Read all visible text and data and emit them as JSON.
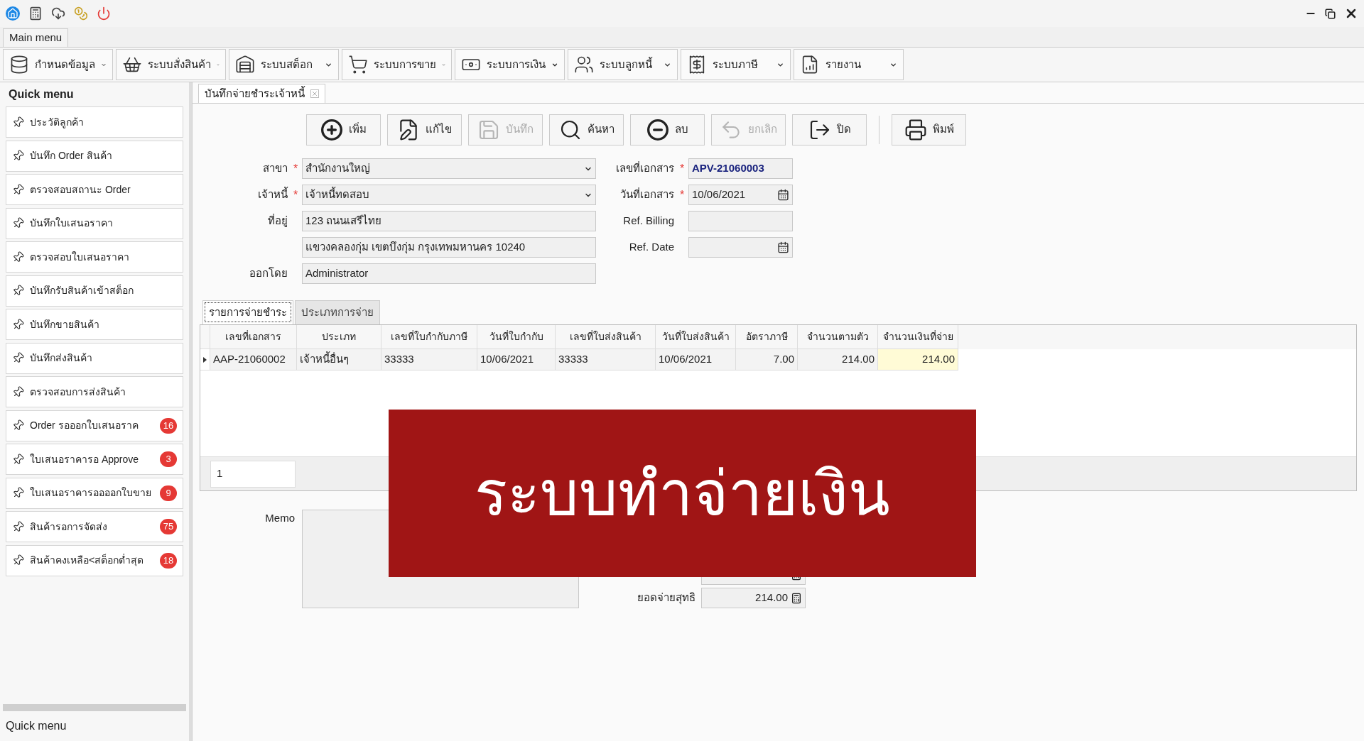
{
  "main_menu_tab": "Main menu",
  "menu_buttons": [
    {
      "label": "กำหนดข้อมูล"
    },
    {
      "label": "ระบบสั่งสินค้า"
    },
    {
      "label": "ระบบสต็อก"
    },
    {
      "label": "ระบบการขาย"
    },
    {
      "label": "ระบบการเงิน"
    },
    {
      "label": "ระบบลูกหนี้"
    },
    {
      "label": "ระบบภาษี"
    },
    {
      "label": "รายงาน"
    }
  ],
  "sidebar": {
    "title": "Quick menu",
    "items": [
      {
        "label": "ประวัติลูกค้า"
      },
      {
        "label": "บันทึก Order สินค้า"
      },
      {
        "label": "ตรวจสอบสถานะ Order"
      },
      {
        "label": "บันทึกใบเสนอราคา"
      },
      {
        "label": "ตรวจสอบใบเสนอราคา"
      },
      {
        "label": "บันทึกรับสินค้าเข้าสต็อก"
      },
      {
        "label": "บันทึกขายสินค้า"
      },
      {
        "label": "บันทึกส่งสินค้า"
      },
      {
        "label": "ตรวจสอบการส่งสินค้า"
      },
      {
        "label": "Order รอออกใบเสนอราค",
        "badge": "16"
      },
      {
        "label": "ใบเสนอราคารอ Approve",
        "badge": "3"
      },
      {
        "label": "ใบเสนอราคารออออกใบขาย",
        "badge": "9"
      },
      {
        "label": "สินค้ารอการจัดส่ง",
        "badge": "75"
      },
      {
        "label": "สินค้าคงเหลือ<สต็อกต่ำสุด",
        "badge": "18"
      }
    ],
    "footer": "Quick menu"
  },
  "document_tabs": [
    {
      "label": "บันทึกจ่ายชำระเจ้าหนี้",
      "selected": true
    }
  ],
  "actions": [
    {
      "label": "เพิ่ม",
      "disabled": false
    },
    {
      "label": "แก้ไข",
      "disabled": false
    },
    {
      "label": "บันทึก",
      "disabled": true
    },
    {
      "label": "ค้นหา",
      "disabled": false
    },
    {
      "label": "ลบ",
      "disabled": false
    },
    {
      "label": "ยกเลิก",
      "disabled": true
    },
    {
      "label": "ปิด",
      "disabled": false
    },
    {
      "label": "พิมพ์",
      "disabled": false
    }
  ],
  "form_left": [
    {
      "label": "สาขา",
      "required_mark": "*",
      "kind": "dropdown",
      "value": "สำนักงานใหญ่"
    },
    {
      "label": "เจ้าหนี้",
      "required_mark": "*",
      "kind": "dropdown",
      "value": "เจ้าหนี้ทดสอบ"
    },
    {
      "label": "ที่อยู่",
      "kind": "text",
      "value": "123 ถนนเสรีไทย"
    },
    {
      "kind": "text",
      "value": "แขวงคลองกุ่ม เขตบึงกุ่ม กรุงเทพมหานคร 10240"
    },
    {
      "label": "ออกโดย",
      "kind": "text",
      "value": "Administrator"
    }
  ],
  "form_right": [
    {
      "label": "เลขที่เอกสาร",
      "required_mark": "*",
      "kind": "text",
      "value": "APV-21060003",
      "emphasis": true
    },
    {
      "label": "วันที่เอกสาร",
      "required_mark": "*",
      "kind": "date",
      "value": "10/06/2021"
    },
    {
      "label": "Ref. Billing",
      "kind": "text"
    },
    {
      "label": "Ref. Date",
      "kind": "date"
    }
  ],
  "detail_tabs": [
    {
      "label": "รายการจ่ายชำระ",
      "selected": true
    },
    {
      "label": "ประเภทการจ่าย",
      "selected": false
    }
  ],
  "grid": {
    "columns": [
      "เลขที่เอกสาร",
      "ประเภท",
      "เลขที่ใบกำกับภาษี",
      "วันที่ใบกำกับ",
      "เลขที่ใบส่งสินค้า",
      "วันที่ใบส่งสินค้า",
      "อัตราภาษี",
      "จำนวนตามตัว",
      "จำนวนเงินที่จ่าย"
    ],
    "rows": [
      {
        "selected": true,
        "cells": [
          {
            "text": "AAP-21060002",
            "focused": false
          },
          {
            "text": "เจ้าหนี้อื่นๆ",
            "focused": false
          },
          {
            "text": "33333",
            "focused": false
          },
          {
            "text": "10/06/2021",
            "focused": false
          },
          {
            "text": "33333",
            "focused": false
          },
          {
            "text": "10/06/2021",
            "focused": false
          },
          {
            "text": "7.00",
            "focused": false
          },
          {
            "text": "214.00",
            "focused": false
          },
          {
            "text": "214.00",
            "focused": true
          }
        ]
      }
    ],
    "footer_value": "1"
  },
  "memo": {
    "label": "Memo"
  },
  "net_total": {
    "label": "ยอดจ่ายสุทธิ",
    "value": "214.00"
  },
  "banner": "ระบบทำจ่ายเงิน"
}
